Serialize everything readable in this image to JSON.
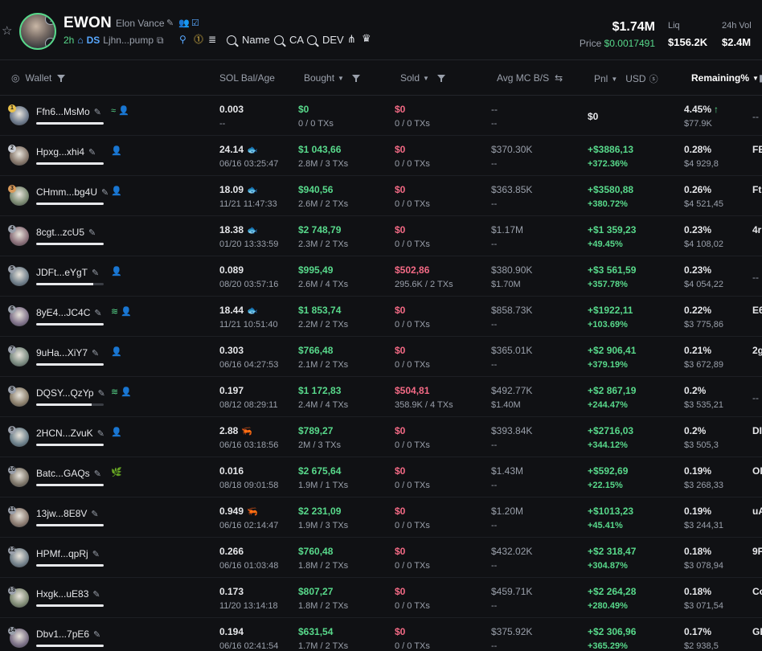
{
  "header": {
    "symbol": "EWON",
    "name": "Elon Vance",
    "age": "2h",
    "ds": "DS",
    "address": "Ljhn...pump",
    "search_name": "Name",
    "search_ca": "CA",
    "search_dev": "DEV",
    "market_cap": "$1.74M",
    "price_label": "Price",
    "price_value": "$0.0017491",
    "liq_label": "Liq",
    "liq_value": "$156.2K",
    "vol_label": "24h Vol",
    "vol_value": "$2.4M",
    "avatar_top_badge": "!",
    "avatar_bottom_badge": "◔"
  },
  "columns": {
    "wallet": "Wallet",
    "sol_bal": "SOL Bal/Age",
    "bought": "Bought",
    "sold": "Sold",
    "avg_mc": "Avg MC B/S",
    "pnl": "Pnl",
    "usd": "USD",
    "remaining": "Remaining%"
  },
  "colors": {
    "green": "#58d98b",
    "red": "#f36a85",
    "accent_blue": "#58a8ff"
  },
  "rows": [
    {
      "rank": "1",
      "rank_color": "#e8c04a",
      "wallet": "Ffn6...MsMo",
      "tags": "≈ 👤",
      "bal_fill": 1.0,
      "sol": "0.003",
      "age": "--",
      "bought": "$0",
      "bought_sub": "0 / 0 TXs",
      "sold": "$0",
      "sold_sub": "0 / 0 TXs",
      "avg_b": "--",
      "avg_s": "--",
      "pnl": "$0",
      "pnl_pct": "",
      "remain": "4.45%",
      "remain_usd": "$77.9K",
      "extra": "--",
      "whale": "",
      "up": "↑"
    },
    {
      "rank": "2",
      "rank_color": "#c8ccd4",
      "wallet": "Hpxg...xhi4",
      "tags": "👤",
      "bal_fill": 1.0,
      "sol": "24.14",
      "age": "06/16 03:25:47",
      "bought": "$1 043,66",
      "bought_sub": "2.8M / 3 TXs",
      "sold": "$0",
      "sold_sub": "0 / 0 TXs",
      "avg_b": "$370.30K",
      "avg_s": "--",
      "pnl": "+$3886,13",
      "pnl_pct": "+372.36%",
      "remain": "0.28%",
      "remain_usd": "$4 929,8",
      "extra": "FE",
      "whale": "fish",
      "up": ""
    },
    {
      "rank": "3",
      "rank_color": "#d99a5a",
      "wallet": "CHmm...bg4U",
      "tags": "👤",
      "bal_fill": 1.0,
      "sol": "18.09",
      "age": "11/21 11:47:33",
      "bought": "$940,56",
      "bought_sub": "2.6M / 2 TXs",
      "sold": "$0",
      "sold_sub": "0 / 0 TXs",
      "avg_b": "$363.85K",
      "avg_s": "--",
      "pnl": "+$3580,88",
      "pnl_pct": "+380.72%",
      "remain": "0.26%",
      "remain_usd": "$4 521,45",
      "extra": "Ft",
      "whale": "fish",
      "up": ""
    },
    {
      "rank": "4",
      "rank_color": "#9aa0ab",
      "wallet": "8cgt...zcU5",
      "tags": "",
      "bal_fill": 1.0,
      "sol": "18.38",
      "age": "01/20 13:33:59",
      "bought": "$2 748,79",
      "bought_sub": "2.3M / 2 TXs",
      "sold": "$0",
      "sold_sub": "0 / 0 TXs",
      "avg_b": "$1.17M",
      "avg_s": "--",
      "pnl": "+$1 359,23",
      "pnl_pct": "+49.45%",
      "remain": "0.23%",
      "remain_usd": "$4 108,02",
      "extra": "4r",
      "whale": "fish",
      "up": ""
    },
    {
      "rank": "5",
      "rank_color": "#9aa0ab",
      "wallet": "JDFt...eYgT",
      "tags": "👤",
      "bal_fill": 0.85,
      "sol": "0.089",
      "age": "08/20 03:57:16",
      "bought": "$995,49",
      "bought_sub": "2.6M / 4 TXs",
      "sold": "$502,86",
      "sold_sub": "295.6K / 2 TXs",
      "avg_b": "$380.90K",
      "avg_s": "$1.70M",
      "pnl": "+$3 561,59",
      "pnl_pct": "+357.78%",
      "remain": "0.23%",
      "remain_usd": "$4 054,22",
      "extra": "--",
      "whale": "",
      "up": ""
    },
    {
      "rank": "6",
      "rank_color": "#9aa0ab",
      "wallet": "8yE4...JC4C",
      "tags": "≋ 👤",
      "bal_fill": 1.0,
      "sol": "18.44",
      "age": "11/21 10:51:40",
      "bought": "$1 853,74",
      "bought_sub": "2.2M / 2 TXs",
      "sold": "$0",
      "sold_sub": "0 / 0 TXs",
      "avg_b": "$858.73K",
      "avg_s": "--",
      "pnl": "+$1922,11",
      "pnl_pct": "+103.69%",
      "remain": "0.22%",
      "remain_usd": "$3 775,86",
      "extra": "E6",
      "whale": "fish",
      "up": ""
    },
    {
      "rank": "7",
      "rank_color": "#9aa0ab",
      "wallet": "9uHa...XiY7",
      "tags": "👤",
      "bal_fill": 1.0,
      "sol": "0.303",
      "age": "06/16 04:27:53",
      "bought": "$766,48",
      "bought_sub": "2.1M / 2 TXs",
      "sold": "$0",
      "sold_sub": "0 / 0 TXs",
      "avg_b": "$365.01K",
      "avg_s": "--",
      "pnl": "+$2 906,41",
      "pnl_pct": "+379.19%",
      "remain": "0.21%",
      "remain_usd": "$3 672,89",
      "extra": "2g",
      "whale": "",
      "up": ""
    },
    {
      "rank": "8",
      "rank_color": "#9aa0ab",
      "wallet": "DQSY...QzYp",
      "tags": "≋ 👤",
      "bal_fill": 0.82,
      "sol": "0.197",
      "age": "08/12 08:29:11",
      "bought": "$1 172,83",
      "bought_sub": "2.4M / 4 TXs",
      "sold": "$504,81",
      "sold_sub": "358.9K / 4 TXs",
      "avg_b": "$492.77K",
      "avg_s": "$1.40M",
      "pnl": "+$2 867,19",
      "pnl_pct": "+244.47%",
      "remain": "0.2%",
      "remain_usd": "$3 535,21",
      "extra": "--",
      "whale": "",
      "up": ""
    },
    {
      "rank": "9",
      "rank_color": "#9aa0ab",
      "wallet": "2HCN...ZvuK",
      "tags": "👤",
      "bal_fill": 1.0,
      "sol": "2.88",
      "age": "06/16 03:18:56",
      "bought": "$789,27",
      "bought_sub": "2M / 3 TXs",
      "sold": "$0",
      "sold_sub": "0 / 0 TXs",
      "avg_b": "$393.84K",
      "avg_s": "--",
      "pnl": "+$2716,03",
      "pnl_pct": "+344.12%",
      "remain": "0.2%",
      "remain_usd": "$3 505,3",
      "extra": "DI",
      "whale": "shrimp",
      "up": ""
    },
    {
      "rank": "10",
      "rank_color": "#9aa0ab",
      "wallet": "Batc...GAQs",
      "tags": "🌿",
      "bal_fill": 1.0,
      "sol": "0.016",
      "age": "08/18 09:01:58",
      "bought": "$2 675,64",
      "bought_sub": "1.9M / 1 TXs",
      "sold": "$0",
      "sold_sub": "0 / 0 TXs",
      "avg_b": "$1.43M",
      "avg_s": "--",
      "pnl": "+$592,69",
      "pnl_pct": "+22.15%",
      "remain": "0.19%",
      "remain_usd": "$3 268,33",
      "extra": "OI",
      "whale": "",
      "up": ""
    },
    {
      "rank": "11",
      "rank_color": "#9aa0ab",
      "wallet": "13jw...8E8V",
      "tags": "",
      "bal_fill": 1.0,
      "sol": "0.949",
      "age": "06/16 02:14:47",
      "bought": "$2 231,09",
      "bought_sub": "1.9M / 3 TXs",
      "sold": "$0",
      "sold_sub": "0 / 0 TXs",
      "avg_b": "$1.20M",
      "avg_s": "--",
      "pnl": "+$1013,23",
      "pnl_pct": "+45.41%",
      "remain": "0.19%",
      "remain_usd": "$3 244,31",
      "extra": "uA",
      "whale": "shrimp",
      "up": ""
    },
    {
      "rank": "12",
      "rank_color": "#9aa0ab",
      "wallet": "HPMf...qpRj",
      "tags": "",
      "bal_fill": 1.0,
      "sol": "0.266",
      "age": "06/16 01:03:48",
      "bought": "$760,48",
      "bought_sub": "1.8M / 2 TXs",
      "sold": "$0",
      "sold_sub": "0 / 0 TXs",
      "avg_b": "$432.02K",
      "avg_s": "--",
      "pnl": "+$2 318,47",
      "pnl_pct": "+304.87%",
      "remain": "0.18%",
      "remain_usd": "$3 078,94",
      "extra": "9F",
      "whale": "",
      "up": ""
    },
    {
      "rank": "13",
      "rank_color": "#9aa0ab",
      "wallet": "Hxgk...uE83",
      "tags": "",
      "bal_fill": 1.0,
      "sol": "0.173",
      "age": "11/20 13:14:18",
      "bought": "$807,27",
      "bought_sub": "1.8M / 2 TXs",
      "sold": "$0",
      "sold_sub": "0 / 0 TXs",
      "avg_b": "$459.71K",
      "avg_s": "--",
      "pnl": "+$2 264,28",
      "pnl_pct": "+280.49%",
      "remain": "0.18%",
      "remain_usd": "$3 071,54",
      "extra": "Co",
      "whale": "",
      "up": ""
    },
    {
      "rank": "14",
      "rank_color": "#9aa0ab",
      "wallet": "Dbv1...7pE6",
      "tags": "",
      "bal_fill": 1.0,
      "sol": "0.194",
      "age": "06/16 02:41:54",
      "bought": "$631,54",
      "bought_sub": "1.7M / 2 TXs",
      "sold": "$0",
      "sold_sub": "0 / 0 TXs",
      "avg_b": "$375.92K",
      "avg_s": "--",
      "pnl": "+$2 306,96",
      "pnl_pct": "+365.29%",
      "remain": "0.17%",
      "remain_usd": "$2 938,5",
      "extra": "GE",
      "whale": "",
      "up": ""
    }
  ]
}
